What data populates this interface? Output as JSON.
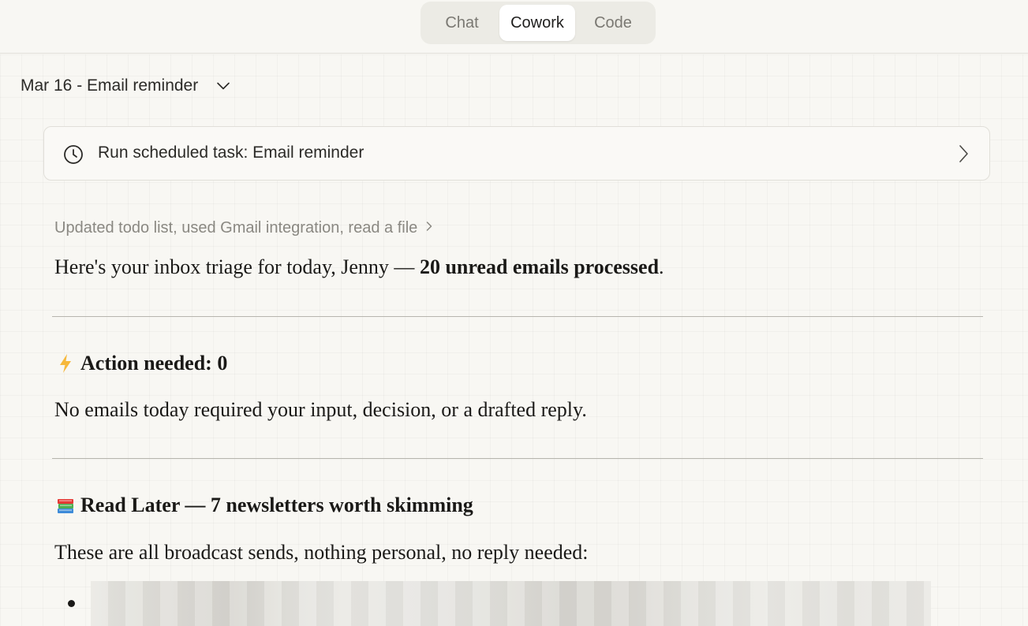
{
  "mode_switch": {
    "tabs": [
      {
        "label": "Chat",
        "active": false
      },
      {
        "label": "Cowork",
        "active": true
      },
      {
        "label": "Code",
        "active": false
      }
    ]
  },
  "conversation": {
    "title": "Mar 16 - Email reminder"
  },
  "task_card": {
    "label": "Run scheduled task: Email reminder",
    "icon": "clock-icon"
  },
  "activity_summary": "Updated todo list, used Gmail integration, read a file",
  "message": {
    "intro_text": "Here's your inbox triage for today, Jenny — ",
    "intro_bold": "20 unread emails processed",
    "intro_end": ".",
    "sections": [
      {
        "emoji": "lightning",
        "heading": "Action needed: 0",
        "body": "No emails today required your input, decision, or a drafted reply."
      },
      {
        "emoji": "books",
        "heading": "Read Later — 7 newsletters worth skimming",
        "body": "These are all broadcast sends, nothing personal, no reply needed:"
      }
    ]
  },
  "colors": {
    "background": "#f8f7f3",
    "lightning": "#f6b83b",
    "text": "#1a1917",
    "muted": "#8a8882"
  }
}
